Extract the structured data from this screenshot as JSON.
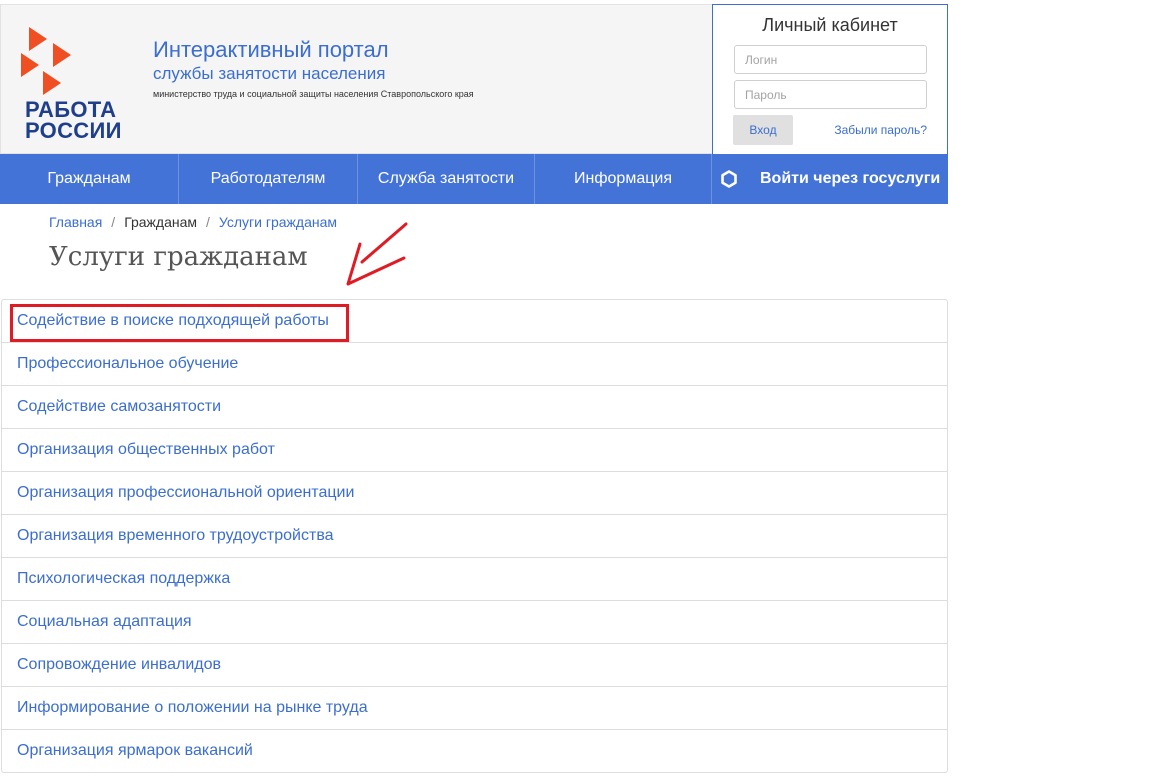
{
  "header": {
    "logo_text_line1": "РАБОТА",
    "logo_text_line2": "РОССИИ",
    "portal_title": "Интерактивный портал",
    "portal_subtitle": "службы занятости населения",
    "ministry": "министерство труда и социальной защиты населения Ставропольского края",
    "brand_colors": {
      "blue": "#1f3f8c",
      "red": "#f04e23",
      "link": "#3b6ed0",
      "nav": "#4473d8"
    }
  },
  "login": {
    "title": "Личный кабинет",
    "login_placeholder": "Логин",
    "password_placeholder": "Пароль",
    "submit_label": "Вход",
    "forgot_label": "Забыли пароль?"
  },
  "nav": {
    "items": [
      {
        "label": "Гражданам"
      },
      {
        "label": "Работодателям"
      },
      {
        "label": "Служба занятости"
      },
      {
        "label": "Информация"
      }
    ],
    "gosuslugi": {
      "label": "Войти через госуслуги",
      "icon": "gosuslugi-icon"
    }
  },
  "breadcrumb": {
    "items": [
      "Главная",
      "Гражданам",
      "Услуги гражданам"
    ]
  },
  "page": {
    "title": "Услуги гражданам"
  },
  "services": [
    "Содействие в поиске подходящей работы",
    "Профессиональное обучение",
    "Содействие самозанятости",
    "Организация общественных работ",
    "Организация профессиональной ориентации",
    "Организация временного трудоустройства",
    "Психологическая поддержка",
    "Социальная адаптация",
    "Сопровождение инвалидов",
    "Информирование о положении на рынке труда",
    "Организация ярмарок вакансий"
  ],
  "annotation": {
    "color": "#e01b24"
  }
}
